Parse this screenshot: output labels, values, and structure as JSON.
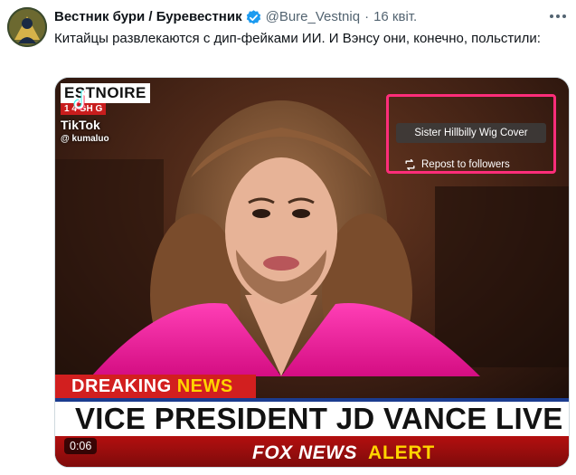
{
  "author": {
    "display_name": "Вестник бури / Буревестник",
    "handle": "@Bure_Vestniq",
    "separator": "·",
    "timestamp": "16 квіт.",
    "verified_icon": "verified-badge-icon",
    "avatar_icon": "avatar"
  },
  "tweet": {
    "text": "Китайцы развлекаются с дип-фейками ИИ.  И Вэнсу они, конечно, польстили:"
  },
  "media": {
    "corner_logo": "ESTNOIRE",
    "corner_sub": "1 4 GH G",
    "tiktok_label": "TikTok",
    "tiktok_user": "@ kumaluo",
    "song_title": "Sister Hillbilly Wig Cover",
    "repost_label": "Repost to followers",
    "breaking_part1": "DREAKING ",
    "breaking_part2": "NEWS",
    "headline": "VICE PRESIDENT JD VANCE LIVE ON",
    "fox_label": "FOX NEWS",
    "alert_label": "ALERT",
    "video_time": "0:06"
  },
  "colors": {
    "accent": "#1d9bf0",
    "highlight": "#ff2d7a",
    "breaking_red": "#d21f1f",
    "suit_pink": "#ff1aa0"
  }
}
